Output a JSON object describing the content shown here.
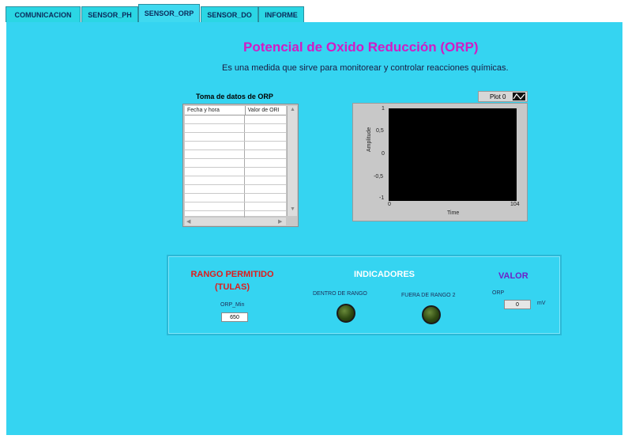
{
  "tabs": [
    "COMUNICACION",
    "SENSOR_PH",
    "SENSOR_ORP",
    "SENSOR_DO",
    "INFORME"
  ],
  "active_tab": "SENSOR_ORP",
  "header": {
    "title": "Potencial de Oxido Reducción (ORP)",
    "subtitle": "Es una medida que sirve para monitorear y controlar reacciones químicas."
  },
  "table": {
    "title": "Toma de datos de ORP",
    "columns": [
      "Fecha y hora",
      "Valor de ORI"
    ]
  },
  "graph": {
    "legend_label": "Plot 0",
    "y_label": "Amplitude",
    "x_label": "Time",
    "y_ticks": [
      "1",
      "0,5",
      "0",
      "-0,5",
      "-1"
    ],
    "x_ticks": [
      "0",
      "104"
    ]
  },
  "indicators": {
    "rango_title_line1": "RANGO PERMITIDO",
    "rango_title_line2": "(TULAS)",
    "indicadores_title": "INDICADORES",
    "valor_title": "VALOR",
    "orp_min_label": "ORP_Min",
    "orp_min_value": "650",
    "dentro_label": "DENTRO DE RANGO",
    "fuera_label": "FUERA DE RANGO 2",
    "orp_label": "ORP",
    "orp_value": "0",
    "orp_unit": "mV"
  },
  "colors": {
    "panel_bg": "#35d4f1",
    "title": "#d21bc4",
    "rango": "#e01b1b",
    "valor": "#6d22c9",
    "led_off": "#2f4a12"
  }
}
